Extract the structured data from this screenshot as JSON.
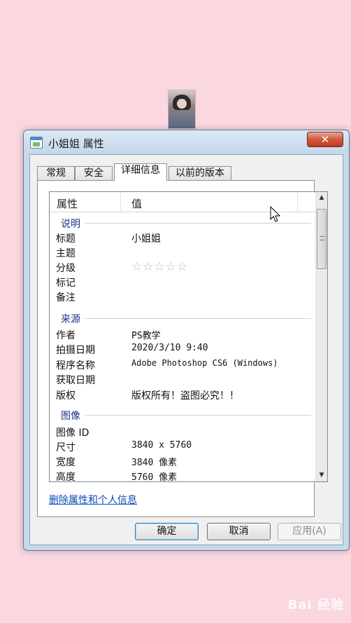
{
  "window": {
    "title": "小姐姐 属性",
    "close_label": "✕"
  },
  "tabs": [
    "常规",
    "安全",
    "详细信息",
    "以前的版本"
  ],
  "active_tab": "详细信息",
  "list": {
    "header": {
      "property": "属性",
      "value": "值"
    },
    "groups": [
      {
        "label": "说明",
        "rows": [
          {
            "key": "标题",
            "value": "小姐姐"
          },
          {
            "key": "主题",
            "value": ""
          },
          {
            "key": "分级",
            "value": "☆☆☆☆☆",
            "rating_stars": 0
          },
          {
            "key": "标记",
            "value": ""
          },
          {
            "key": "备注",
            "value": ""
          }
        ]
      },
      {
        "label": "来源",
        "rows": [
          {
            "key": "作者",
            "value": "PS教学"
          },
          {
            "key": "拍摄日期",
            "value": "2020/3/10 9:40"
          },
          {
            "key": "程序名称",
            "value": "Adobe Photoshop CS6 (Windows)"
          },
          {
            "key": "获取日期",
            "value": ""
          },
          {
            "key": "版权",
            "value": "版权所有！盗图必究！！"
          }
        ]
      },
      {
        "label": "图像",
        "rows": [
          {
            "key": "图像 ID",
            "value": ""
          },
          {
            "key": "尺寸",
            "value": "3840 x 5760"
          },
          {
            "key": "宽度",
            "value": "3840 像素"
          },
          {
            "key": "高度",
            "value": "5760 像素"
          }
        ]
      }
    ]
  },
  "remove_link": "删除属性和个人信息",
  "buttons": {
    "ok": "确定",
    "cancel": "取消",
    "apply": "应用(A)"
  },
  "watermark": "Bai 经验",
  "colors": {
    "background": "#fbd7e0",
    "group_label": "#1e3287",
    "link": "#0a4ab8"
  }
}
